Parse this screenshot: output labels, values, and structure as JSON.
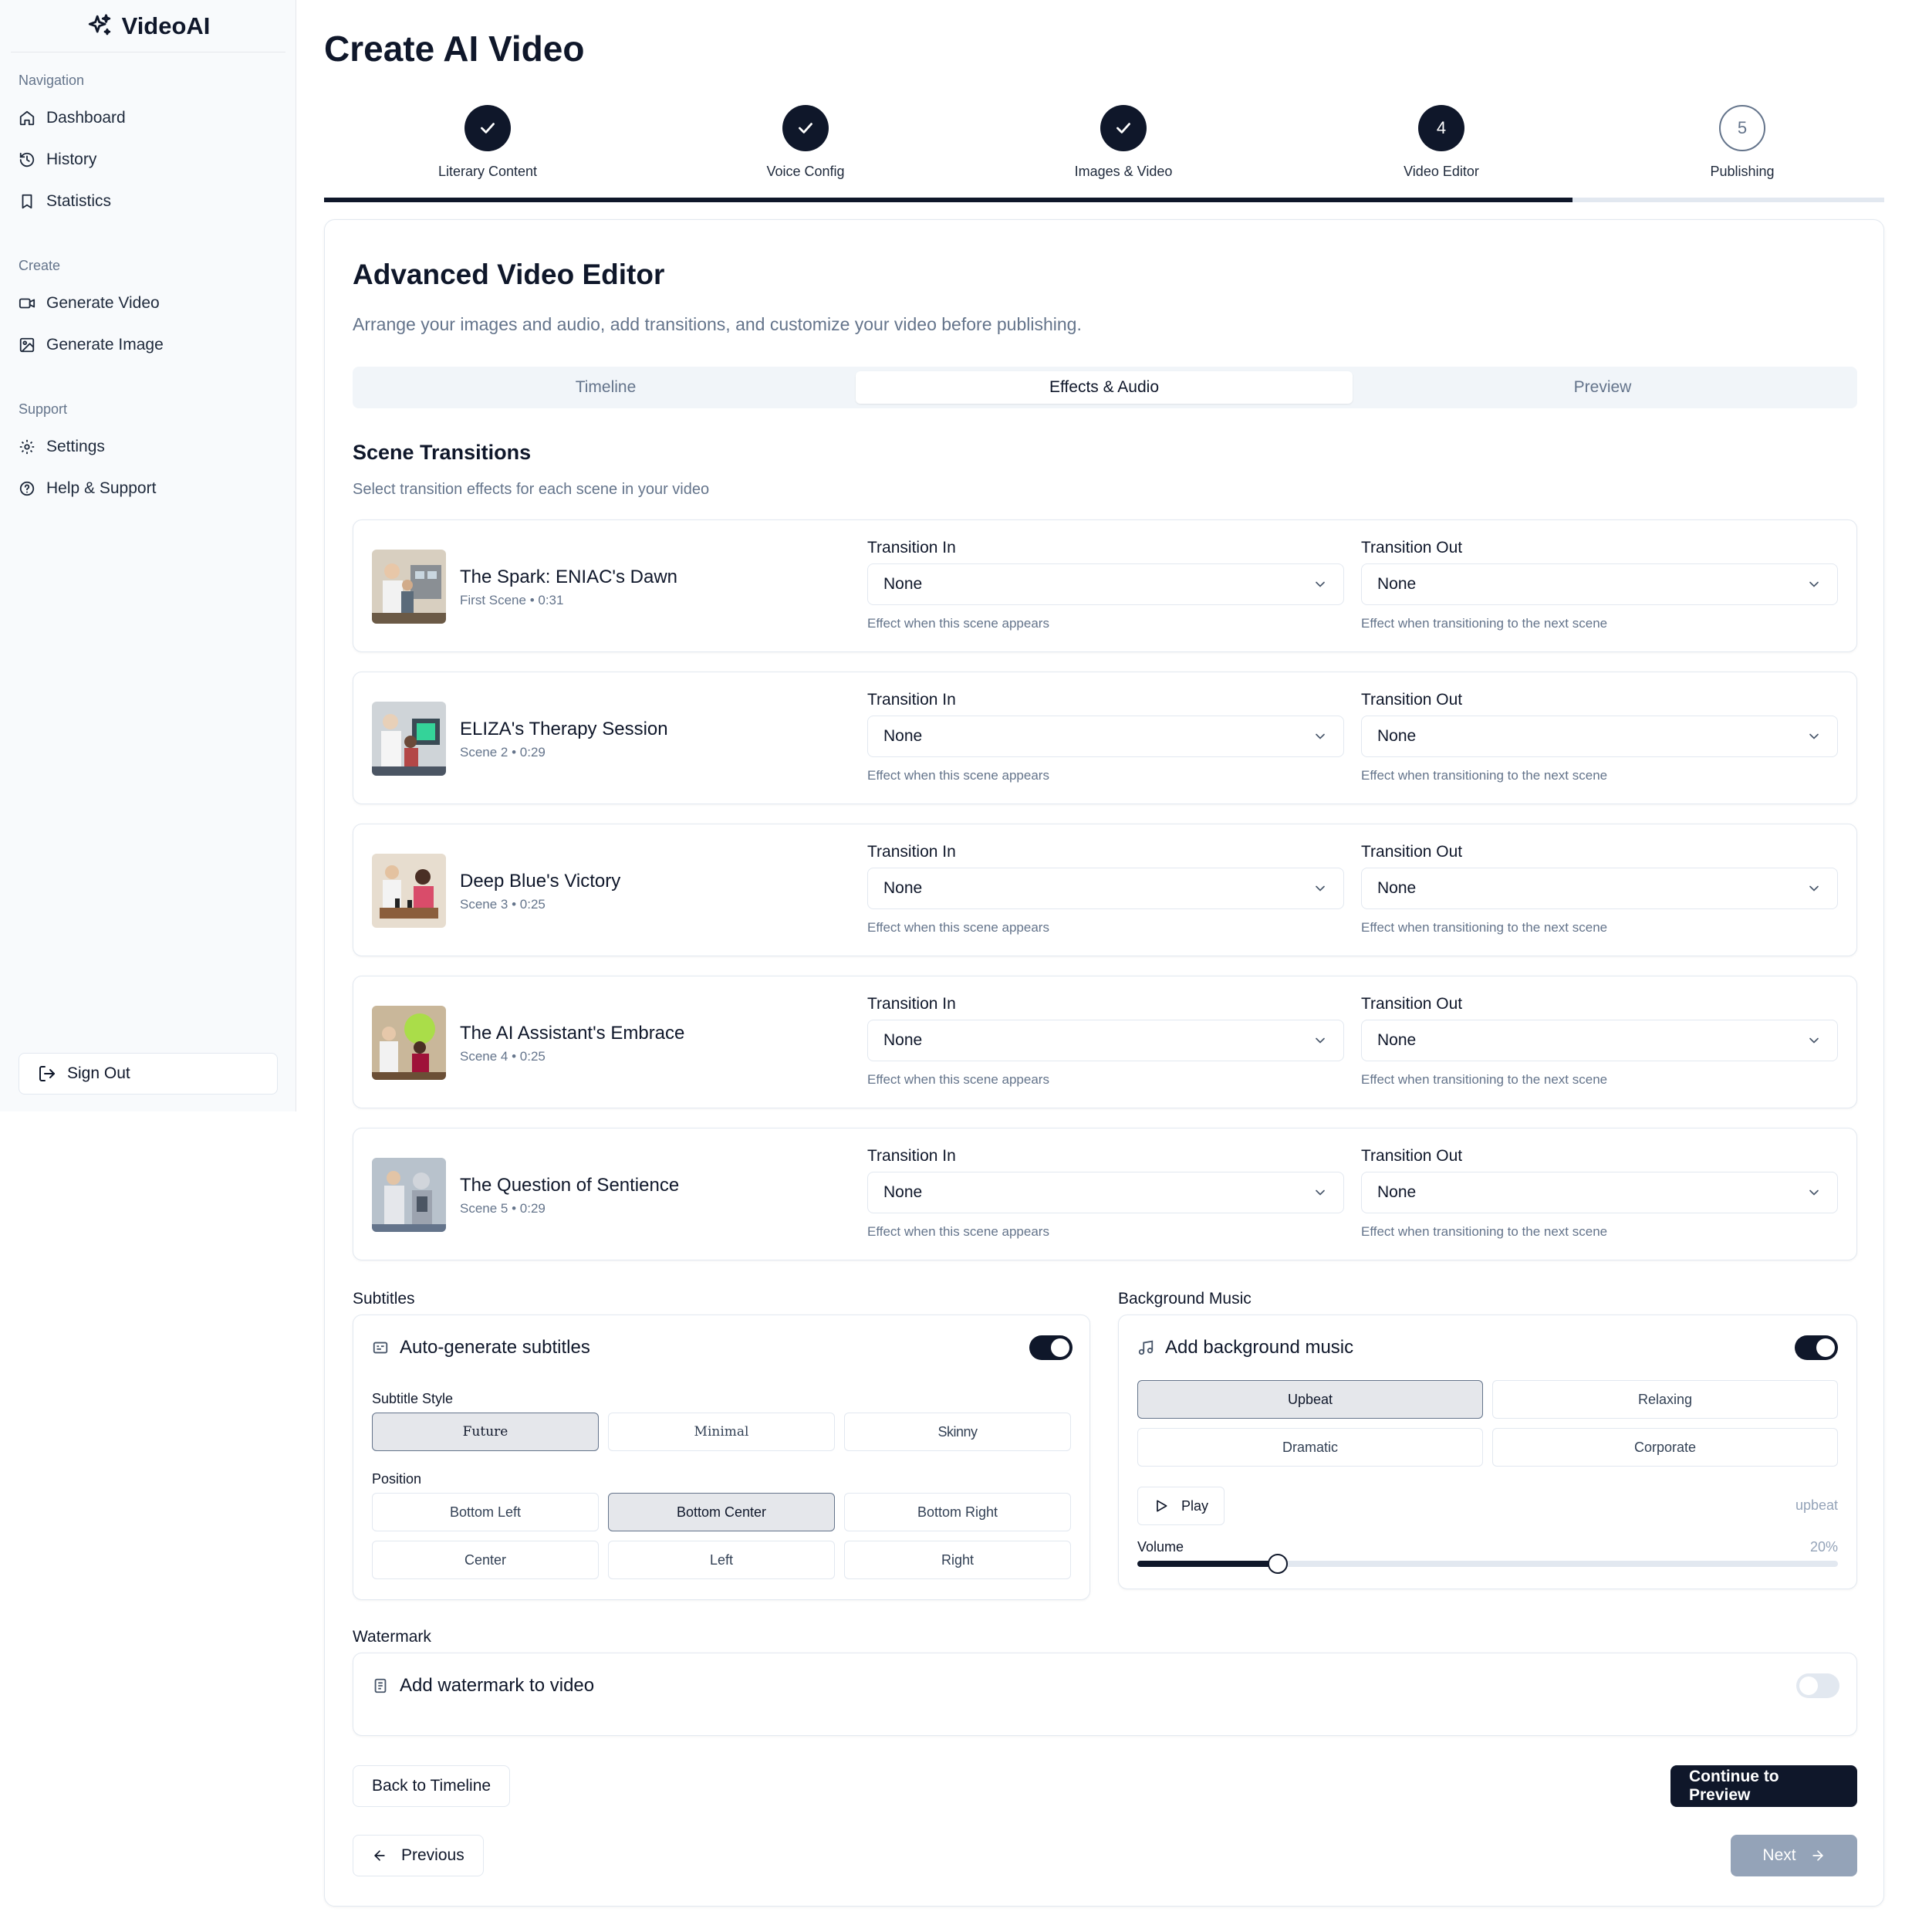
{
  "app": {
    "name": "VideoAI"
  },
  "sidebar": {
    "groups": [
      {
        "label": "Navigation",
        "items": [
          {
            "label": "Dashboard",
            "icon": "home-icon"
          },
          {
            "label": "History",
            "icon": "history-icon"
          },
          {
            "label": "Statistics",
            "icon": "bookmark-icon"
          }
        ]
      },
      {
        "label": "Create",
        "items": [
          {
            "label": "Generate Video",
            "icon": "video-icon"
          },
          {
            "label": "Generate Image",
            "icon": "image-icon"
          }
        ]
      },
      {
        "label": "Support",
        "items": [
          {
            "label": "Settings",
            "icon": "gear-icon"
          },
          {
            "label": "Help & Support",
            "icon": "help-icon"
          }
        ]
      }
    ],
    "sign_out": "Sign Out"
  },
  "page": {
    "title": "Create AI Video"
  },
  "stepper": {
    "steps": [
      {
        "label": "Literary Content",
        "number": "1",
        "state": "done"
      },
      {
        "label": "Voice Config",
        "number": "2",
        "state": "done"
      },
      {
        "label": "Images & Video",
        "number": "3",
        "state": "done"
      },
      {
        "label": "Video Editor",
        "number": "4",
        "state": "current"
      },
      {
        "label": "Publishing",
        "number": "5",
        "state": "pending"
      }
    ],
    "progress": 0.8
  },
  "editor": {
    "title": "Advanced Video Editor",
    "description": "Arrange your images and audio, add transitions, and customize your video before publishing.",
    "tabs": [
      {
        "label": "Timeline"
      },
      {
        "label": "Effects & Audio",
        "active": true
      },
      {
        "label": "Preview"
      }
    ]
  },
  "transitions": {
    "title": "Scene Transitions",
    "subtitle": "Select transition effects for each scene in your video",
    "in_label": "Transition In",
    "out_label": "Transition Out",
    "in_hint": "Effect when this scene appears",
    "out_hint": "Effect when transitioning to the next scene",
    "scenes": [
      {
        "title": "The Spark: ENIAC's Dawn",
        "meta": "First Scene • 0:31",
        "in": "None",
        "out": "None"
      },
      {
        "title": "ELIZA's Therapy Session",
        "meta": "Scene 2 • 0:29",
        "in": "None",
        "out": "None"
      },
      {
        "title": "Deep Blue's Victory",
        "meta": "Scene 3 • 0:25",
        "in": "None",
        "out": "None"
      },
      {
        "title": "The AI Assistant's Embrace",
        "meta": "Scene 4 • 0:25",
        "in": "None",
        "out": "None"
      },
      {
        "title": "The Question of Sentience",
        "meta": "Scene 5 • 0:29",
        "in": "None",
        "out": "None"
      }
    ]
  },
  "subtitles": {
    "section_label": "Subtitles",
    "toggle_label": "Auto-generate subtitles",
    "enabled": true,
    "style_label": "Subtitle Style",
    "styles": [
      {
        "label": "Future",
        "selected": true
      },
      {
        "label": "Minimal"
      },
      {
        "label": "Skinny"
      }
    ],
    "position_label": "Position",
    "positions": [
      {
        "label": "Bottom Left"
      },
      {
        "label": "Bottom Center",
        "selected": true
      },
      {
        "label": "Bottom Right"
      },
      {
        "label": "Center"
      },
      {
        "label": "Left"
      },
      {
        "label": "Right"
      }
    ]
  },
  "music": {
    "section_label": "Background Music",
    "toggle_label": "Add background music",
    "enabled": true,
    "options": [
      {
        "label": "Upbeat",
        "selected": true
      },
      {
        "label": "Relaxing"
      },
      {
        "label": "Dramatic"
      },
      {
        "label": "Corporate"
      }
    ],
    "play_label": "Play",
    "current_track": "upbeat",
    "volume_label": "Volume",
    "volume_text": "20%",
    "volume": 0.2
  },
  "watermark": {
    "section_label": "Watermark",
    "toggle_label": "Add watermark to video",
    "enabled": false
  },
  "actions": {
    "back": "Back to Timeline",
    "continue": "Continue to Preview",
    "previous": "Previous",
    "next": "Next"
  },
  "colors": {
    "primary": "#0f172a",
    "muted": "#64748b",
    "border": "#e2e8f0",
    "sidebar_bg": "#f8fafc"
  }
}
